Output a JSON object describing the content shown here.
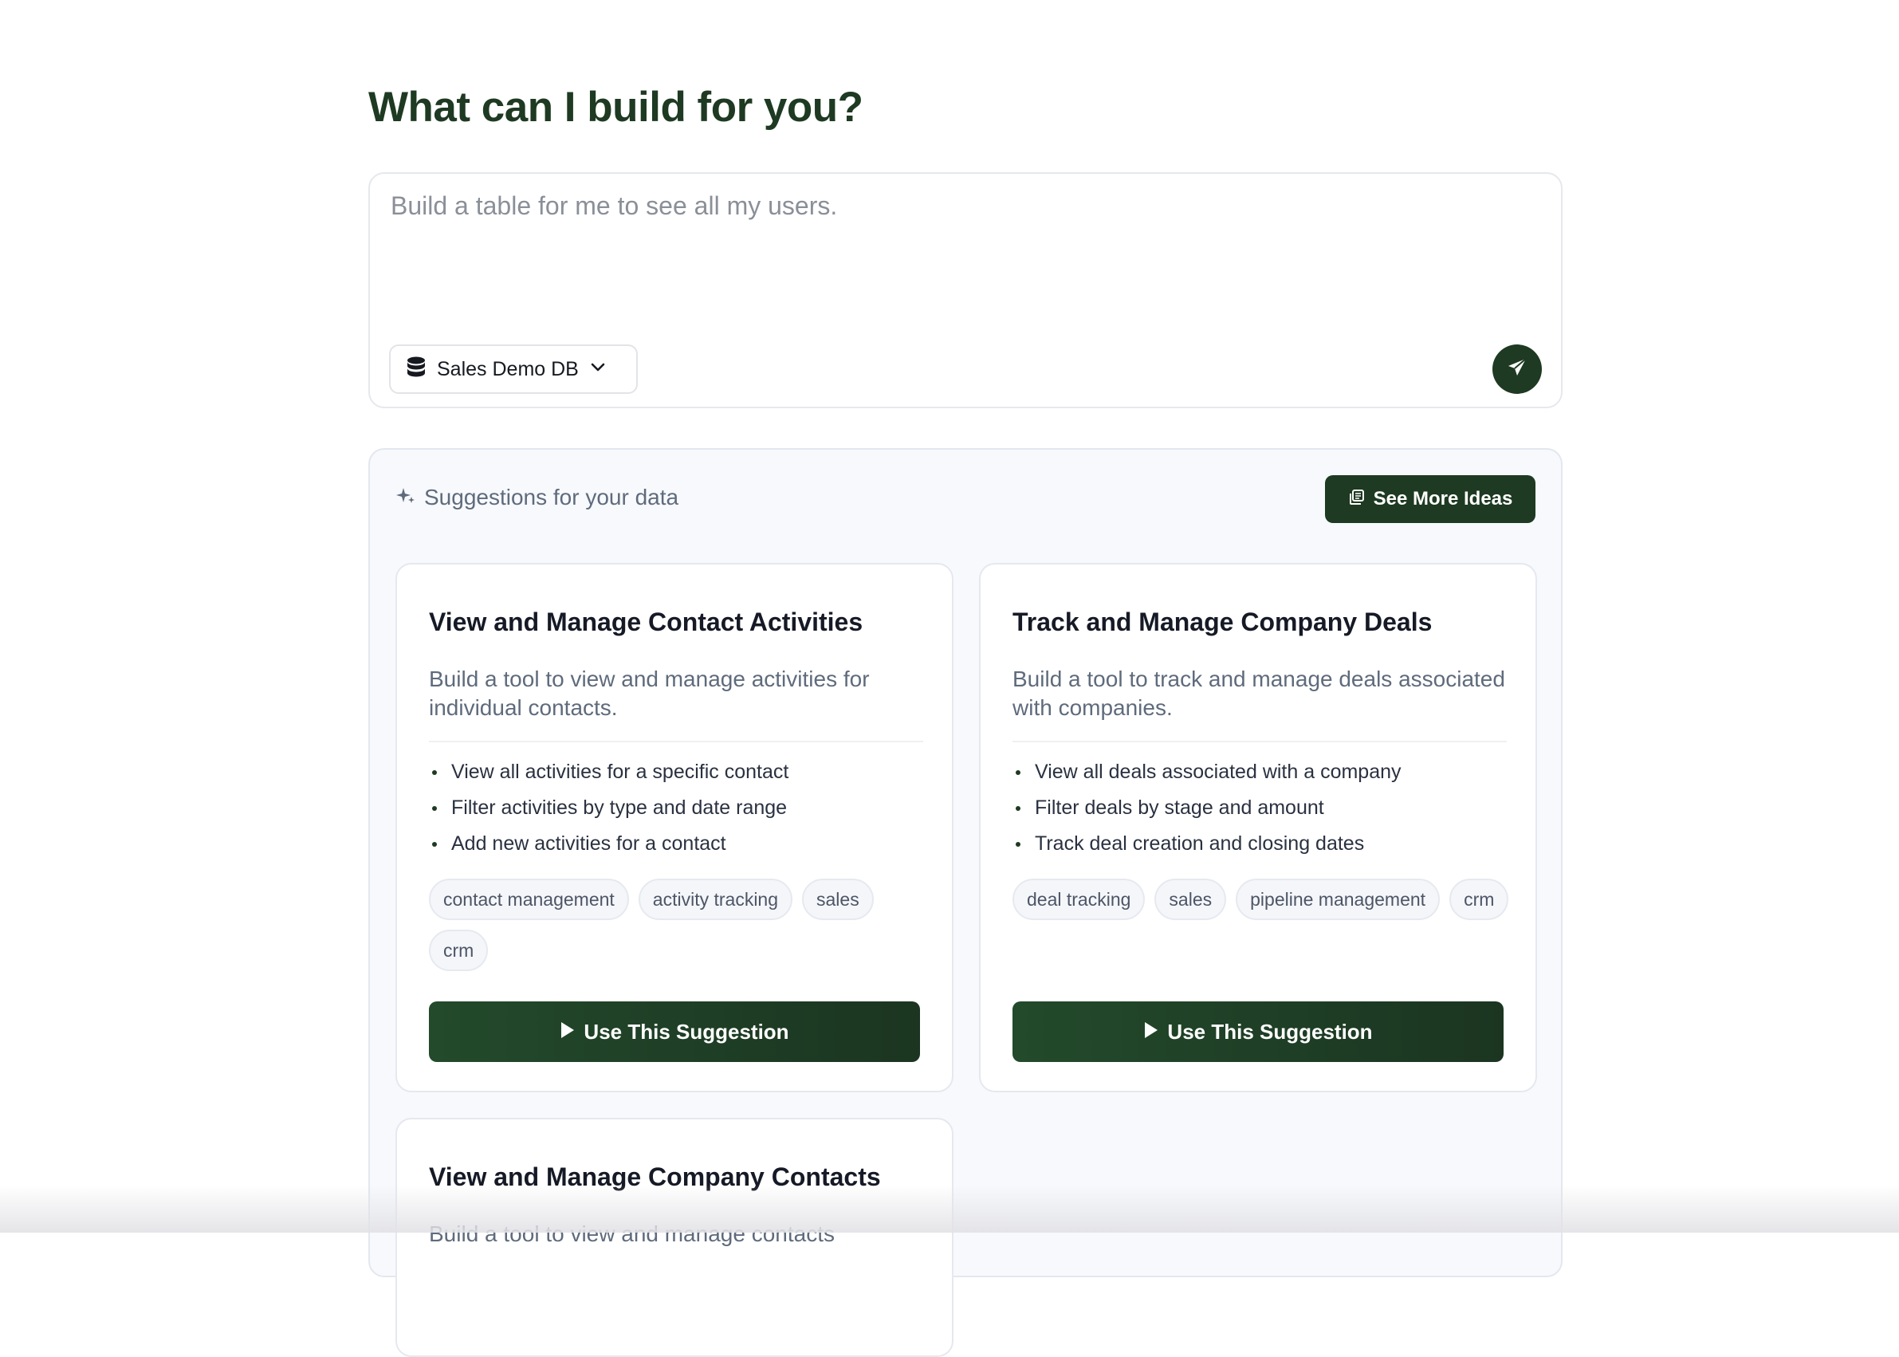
{
  "headline": "What can I build for you?",
  "prompt": {
    "placeholder": "Build a table for me to see all my users.",
    "db_select": {
      "label": "Sales Demo DB",
      "icon": "database-icon"
    },
    "send_icon": "paper-plane-icon"
  },
  "suggestions": {
    "title": "Suggestions for your data",
    "more_button": "See More Ideas",
    "cards": [
      {
        "title": "View and Manage Contact Activities",
        "description": "Build a tool to view and manage activities for individual contacts.",
        "features": [
          "View all activities for a specific contact",
          "Filter activities by type and date range",
          "Add new activities for a contact"
        ],
        "tags": [
          "contact management",
          "activity tracking",
          "sales",
          "crm"
        ],
        "button": "Use This Suggestion"
      },
      {
        "title": "Track and Manage Company Deals",
        "description": "Build a tool to track and manage deals associated with companies.",
        "features": [
          "View all deals associated with a company",
          "Filter deals by stage and amount",
          "Track deal creation and closing dates"
        ],
        "tags": [
          "deal tracking",
          "sales",
          "pipeline management",
          "crm"
        ],
        "button": "Use This Suggestion"
      },
      {
        "title": "View and Manage Company Contacts",
        "description": "Build a tool to view and manage contacts"
      }
    ]
  },
  "colors": {
    "brand": "#1e3a22",
    "muted_text": "#5f6b7c",
    "panel_bg": "#f7f9fc"
  }
}
